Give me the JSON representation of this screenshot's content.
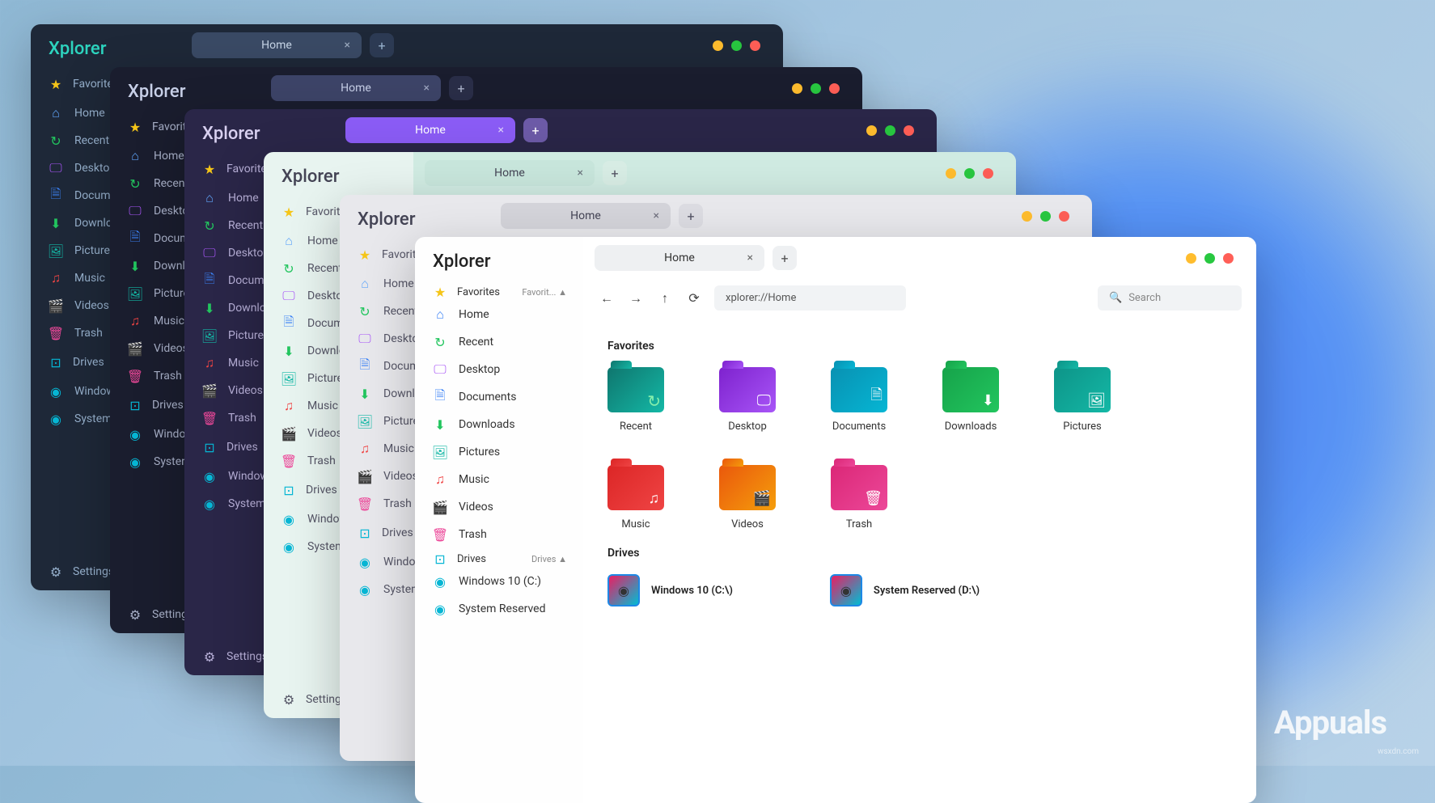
{
  "app": {
    "name": "Xplorer"
  },
  "tab": {
    "label": "Home",
    "close": "×",
    "add": "+"
  },
  "toolbar": {
    "back": "←",
    "forward": "→",
    "up": "↑",
    "refresh": "⟳"
  },
  "address": {
    "value": "xplorer://Home"
  },
  "search": {
    "placeholder": "Search",
    "icon": "🔍"
  },
  "sidebar": {
    "favorites_label": "Favorites",
    "favorites_short": "Favorit...",
    "drives_label": "Drives",
    "settings": "Settings",
    "items": {
      "home": "Home",
      "recent": "Recent",
      "desktop": "Desktop",
      "documents": "Documents",
      "downloads": "Downloads",
      "pictures": "Pictures",
      "music": "Music",
      "videos": "Videos",
      "trash": "Trash"
    },
    "drives": {
      "d1": "Windows 10 (C:)",
      "d2": "System Reserved"
    }
  },
  "content": {
    "favorites_heading": "Favorites",
    "drives_heading": "Drives",
    "tiles": {
      "recent": "Recent",
      "desktop": "Desktop",
      "documents": "Documents",
      "downloads": "Downloads",
      "pictures": "Pictures",
      "music": "Music",
      "videos": "Videos",
      "trash": "Trash"
    },
    "drives": {
      "d1": "Windows 10 (C:\\)",
      "d2": "System Reserved (D:\\)"
    }
  },
  "brand": "Appuals",
  "watermark": "wsxdn.com"
}
